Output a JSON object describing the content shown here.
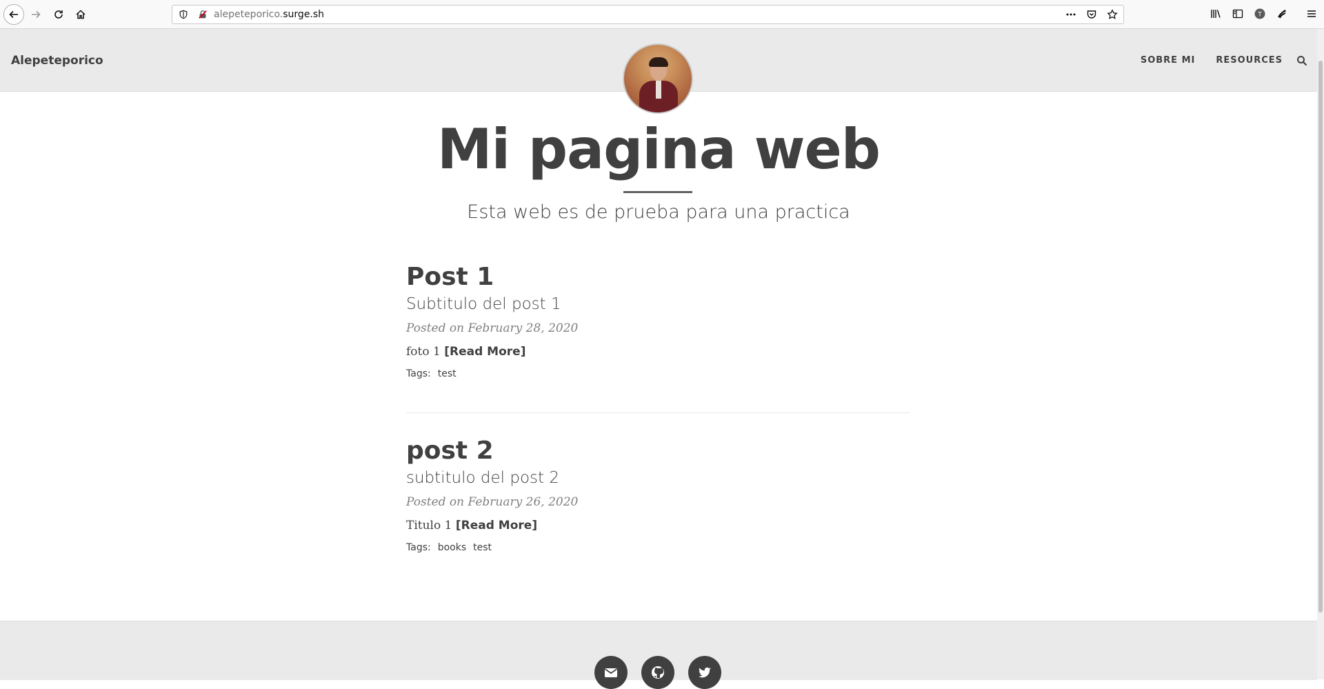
{
  "browser": {
    "url_host_prefix": "alepeteporico.",
    "url_host_main": "surge.sh",
    "icons": [
      "back-icon",
      "forward-icon",
      "reload-icon",
      "home-icon",
      "shield-icon",
      "insecure-lock-icon",
      "more-icon",
      "pocket-icon",
      "bookmark-star-icon",
      "library-icon",
      "sidebar-icon",
      "account-icon",
      "extension-icon",
      "menu-icon"
    ],
    "account_initial": "T"
  },
  "navbar": {
    "brand": "Alepeteporico",
    "links": [
      "SOBRE MI",
      "RESOURCES"
    ],
    "search_icon": "search-icon"
  },
  "header": {
    "title": "Mi pagina web",
    "subtitle": "Esta web es de prueba para una practica"
  },
  "posts": [
    {
      "title": "Post 1",
      "subtitle": "Subtitulo del post 1",
      "meta": "Posted on February 28, 2020",
      "excerpt": "foto 1",
      "read_more": "[Read More]",
      "tags_label": "Tags:",
      "tags": [
        "test"
      ]
    },
    {
      "title": "post 2",
      "subtitle": "subtitulo del post 2",
      "meta": "Posted on February 26, 2020",
      "excerpt": "Titulo 1",
      "read_more": "[Read More]",
      "tags_label": "Tags:",
      "tags": [
        "books",
        "test"
      ]
    }
  ],
  "footer": {
    "social": [
      "email-icon",
      "github-icon",
      "twitter-icon"
    ]
  },
  "colors": {
    "text": "#404040",
    "navbar_bg": "#eaeaea",
    "meta": "#808080"
  }
}
